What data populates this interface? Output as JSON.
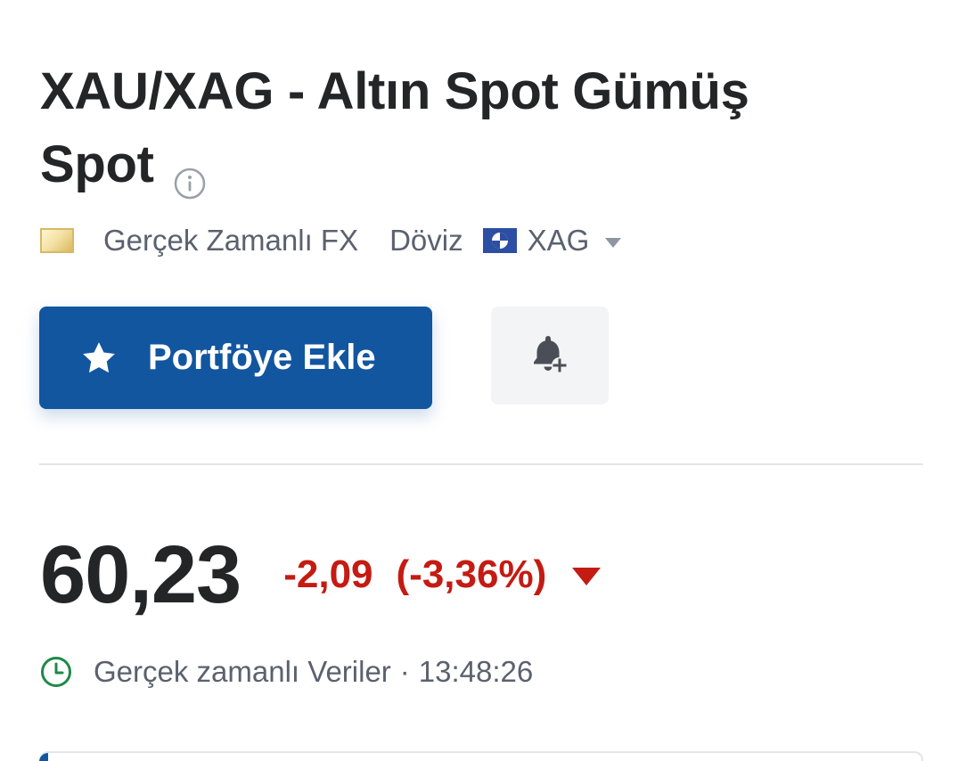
{
  "header": {
    "title": "XAU/XAG - Altın Spot Gümüş Spot",
    "info_icon": "info-circle-icon"
  },
  "meta": {
    "source": "Gerçek Zamanlı FX",
    "type": "Döviz",
    "currency": "XAG",
    "currency_dropdown_icon": "chevron-down-icon"
  },
  "actions": {
    "portfolio_label": "Portföye Ekle",
    "portfolio_icon": "star-icon",
    "alert_icon": "bell-plus-icon"
  },
  "quote": {
    "price": "60,23",
    "change": "-2,09",
    "change_percent": "(-3,36%)",
    "direction_icon": "triangle-down-icon"
  },
  "status": {
    "label": "Gerçek zamanlı Veriler",
    "separator": "·",
    "time": "13:48:26",
    "clock_icon": "clock-icon"
  },
  "colors": {
    "primary": "#1256a0",
    "negative": "#c41b12",
    "text": "#232526",
    "muted": "#5b616e",
    "live_green": "#1f8a47"
  }
}
